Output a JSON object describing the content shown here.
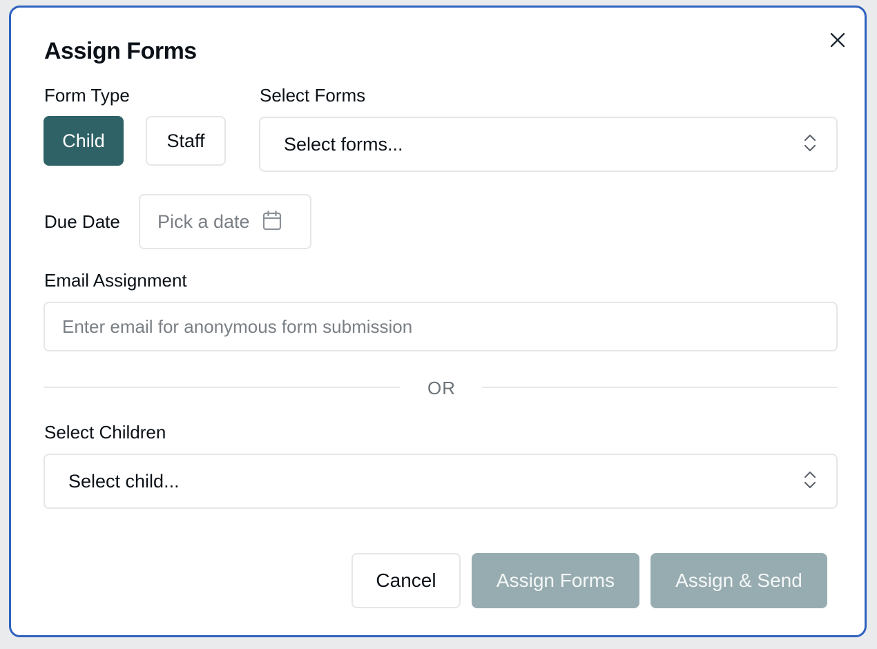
{
  "dialog": {
    "title": "Assign Forms",
    "close_icon": "close-icon"
  },
  "form_type": {
    "label": "Form Type",
    "options": [
      "Child",
      "Staff"
    ],
    "selected": "Child"
  },
  "select_forms": {
    "label": "Select Forms",
    "placeholder": "Select forms...",
    "icon": "chevron-up-down-icon"
  },
  "due_date": {
    "label": "Due Date",
    "placeholder": "Pick a date",
    "icon": "calendar-icon"
  },
  "email_assignment": {
    "label": "Email Assignment",
    "placeholder": "Enter email for anonymous form submission",
    "value": ""
  },
  "separator": {
    "text": "OR"
  },
  "select_children": {
    "label": "Select Children",
    "placeholder": "Select child...",
    "icon": "chevron-up-down-icon"
  },
  "actions": {
    "cancel_label": "Cancel",
    "assign_label": "Assign Forms",
    "assign_send_label": "Assign & Send"
  },
  "colors": {
    "active_toggle": "#2f6266",
    "disabled_button": "#97acb0",
    "dialog_border": "#2e62c0"
  }
}
